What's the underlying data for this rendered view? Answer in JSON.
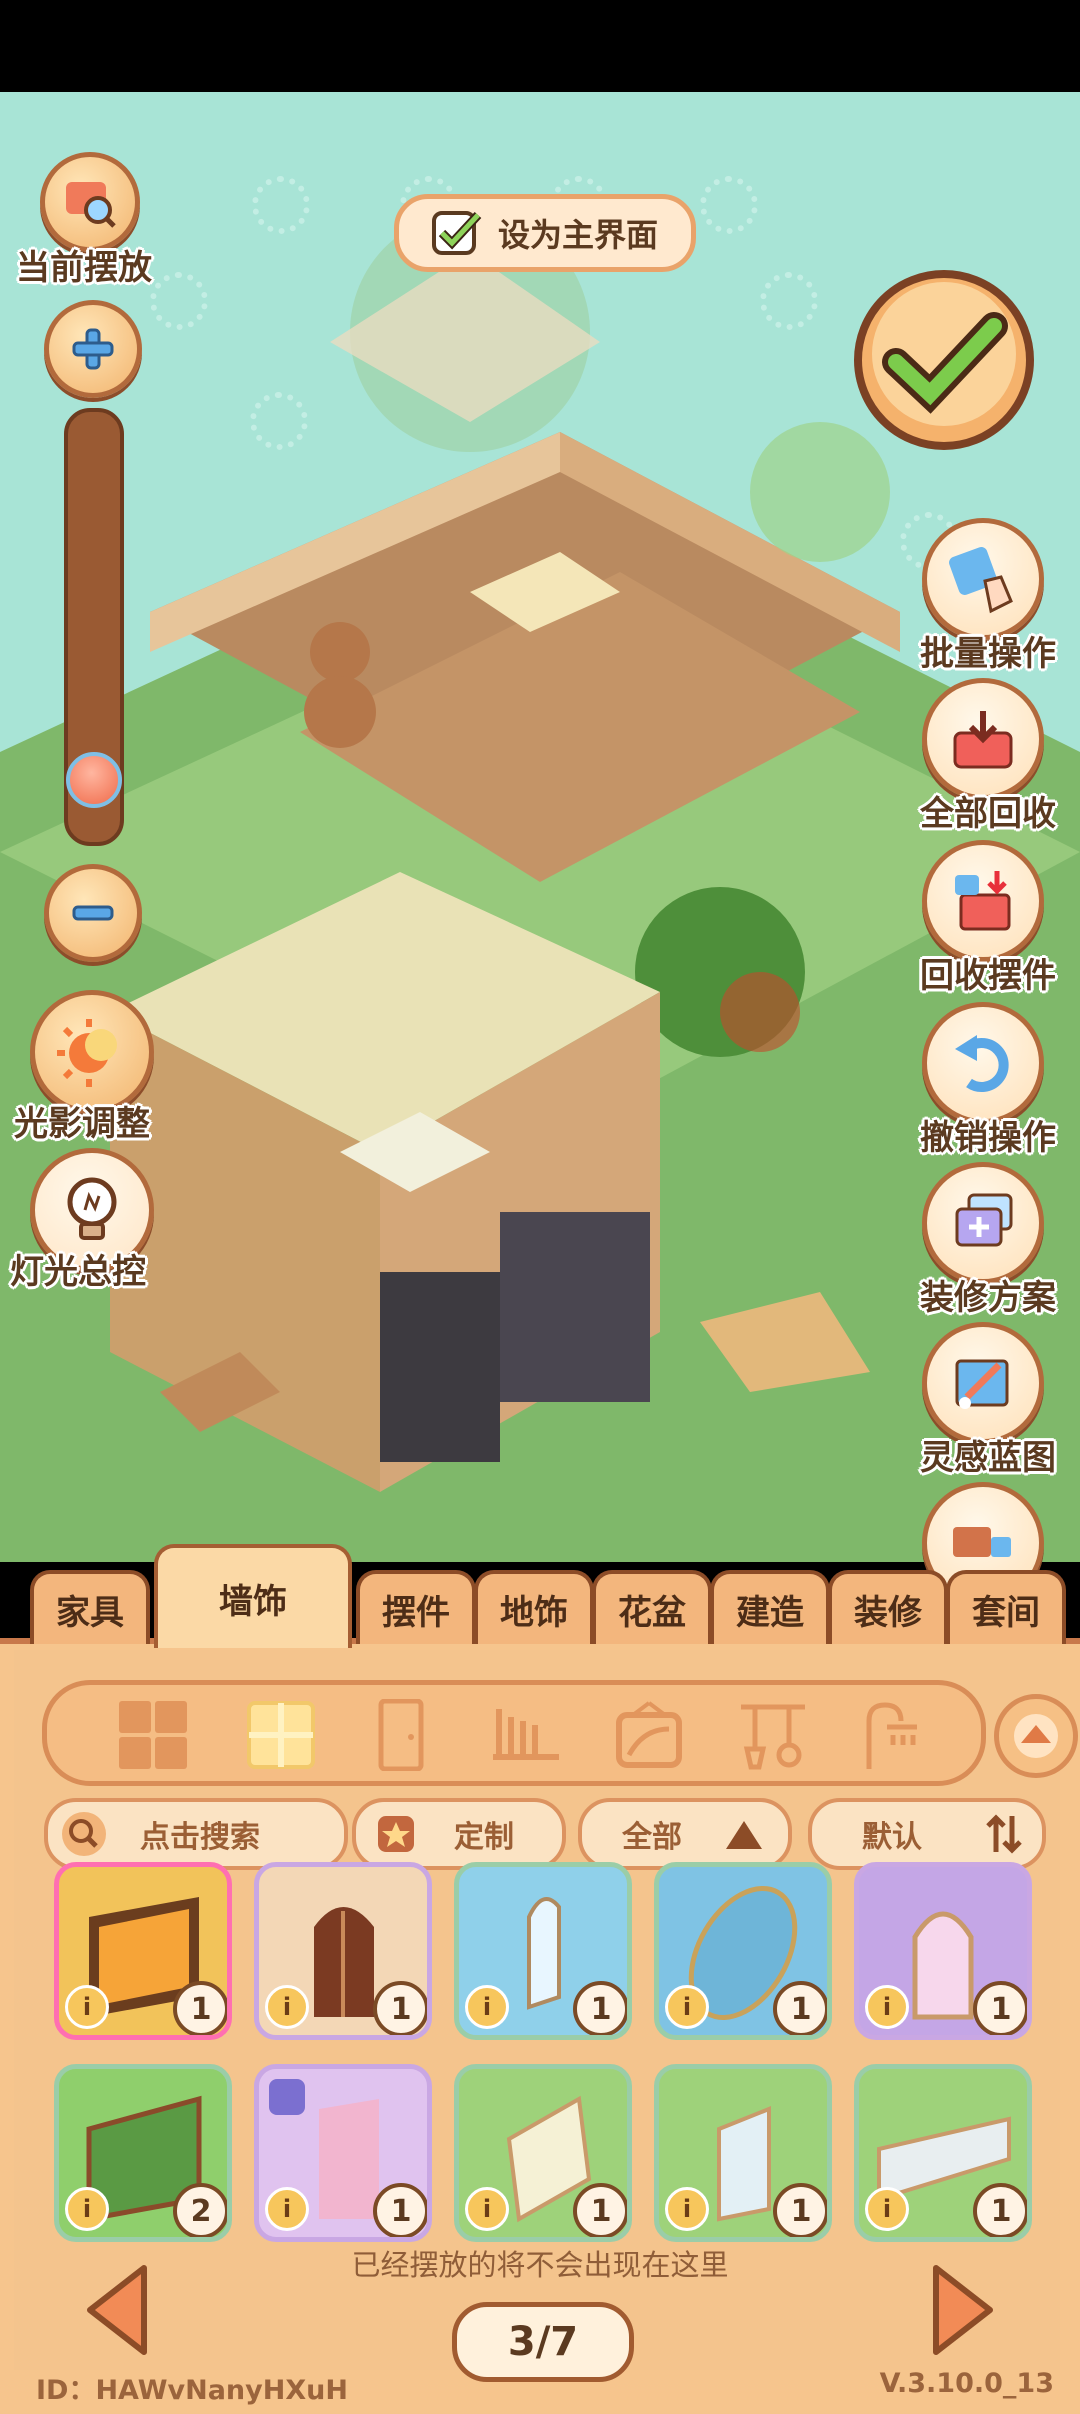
{
  "left_controls": {
    "current_placement_label": "当前摆放",
    "light_shadow_label": "光影调整",
    "light_control_label": "灯光总控",
    "zoom_level": 0.12
  },
  "top": {
    "home_toggle_label": "设为主界面",
    "home_toggle_checked": true
  },
  "right_actions": [
    {
      "label": "批量操作",
      "icon": "hand-tap-icon"
    },
    {
      "label": "全部回收",
      "icon": "recycle-tray-icon"
    },
    {
      "label": "回收摆件",
      "icon": "recycle-box-icon"
    },
    {
      "label": "撤销操作",
      "icon": "undo-icon"
    },
    {
      "label": "装修方案",
      "icon": "layers-add-icon"
    },
    {
      "label": "灵感蓝图",
      "icon": "blueprint-pencil-icon"
    }
  ],
  "tabs": [
    {
      "label": "家具"
    },
    {
      "label": "墙饰",
      "active": true
    },
    {
      "label": "摆件"
    },
    {
      "label": "地饰"
    },
    {
      "label": "花盆"
    },
    {
      "label": "建造"
    },
    {
      "label": "装修"
    },
    {
      "label": "套间"
    }
  ],
  "subcategories": [
    "grid-all-icon",
    "window-icon",
    "door-icon",
    "wall-rack-icon",
    "wall-frame-icon",
    "hanger-tools-icon",
    "shower-icon"
  ],
  "search": {
    "placeholder": "点击搜索"
  },
  "filters": {
    "custom_label": "定制",
    "all_label": "全部",
    "sort_label": "默认"
  },
  "items": [
    {
      "name": "fireplace-window",
      "count": "1",
      "bg": "#f2c35a"
    },
    {
      "name": "arched-wood-door",
      "count": "1",
      "bg": "#f3d7b6"
    },
    {
      "name": "glass-arch-panel",
      "count": "1",
      "bg": "#8fd0ea"
    },
    {
      "name": "stained-mirror",
      "count": "1",
      "bg": "#7fc3e4"
    },
    {
      "name": "pink-arch-gate",
      "count": "1",
      "bg": "#c4a6e6"
    },
    {
      "name": "greenhouse-window",
      "count": "2",
      "bg": "#8fcf6c"
    },
    {
      "name": "pink-curtain",
      "count": "1",
      "bg": "#e0c3ef"
    },
    {
      "name": "wall-mirror-a",
      "count": "1",
      "bg": "#9ed27a"
    },
    {
      "name": "wall-mirror-b",
      "count": "1",
      "bg": "#9ed27a"
    },
    {
      "name": "wall-mirror-c",
      "count": "1",
      "bg": "#9ed27a"
    }
  ],
  "hint": "已经摆放的将不会出现在这里",
  "pager": {
    "label": "3/7"
  },
  "footer": {
    "id": "ID：HAWvNanyHXuH",
    "version": "V.3.10.0_13"
  }
}
